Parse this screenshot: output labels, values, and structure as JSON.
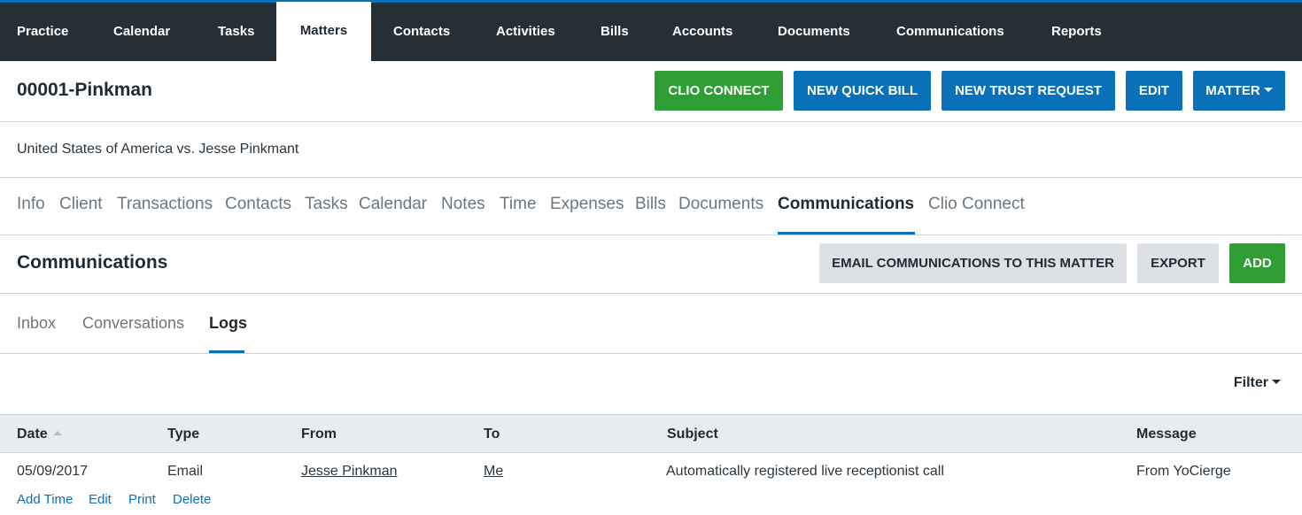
{
  "topnav": {
    "items": [
      {
        "label": "Practice"
      },
      {
        "label": "Calendar"
      },
      {
        "label": "Tasks"
      },
      {
        "label": "Matters"
      },
      {
        "label": "Contacts"
      },
      {
        "label": "Activities"
      },
      {
        "label": "Bills"
      },
      {
        "label": "Accounts"
      },
      {
        "label": "Documents"
      },
      {
        "label": "Communications"
      },
      {
        "label": "Reports"
      }
    ],
    "active": "Matters"
  },
  "header": {
    "title": "00001-Pinkman",
    "buttons": {
      "clio_connect": "CLIO CONNECT",
      "new_quick_bill": "NEW QUICK BILL",
      "new_trust_request": "NEW TRUST REQUEST",
      "edit": "EDIT",
      "matter": "MATTER"
    }
  },
  "matter": {
    "description": "United States of America vs. Jesse Pinkmant"
  },
  "matter_tabs": {
    "items": [
      {
        "label": "Info"
      },
      {
        "label": "Client"
      },
      {
        "label": "Transactions"
      },
      {
        "label": "Contacts"
      },
      {
        "label": "Tasks"
      },
      {
        "label": "Calendar"
      },
      {
        "label": "Notes"
      },
      {
        "label": "Time"
      },
      {
        "label": "Expenses"
      },
      {
        "label": "Bills"
      },
      {
        "label": "Documents"
      },
      {
        "label": "Communications"
      },
      {
        "label": "Clio Connect"
      }
    ],
    "active": "Communications"
  },
  "section": {
    "title": "Communications",
    "buttons": {
      "email_comms": "EMAIL COMMUNICATIONS TO THIS MATTER",
      "export": "EXPORT",
      "add": "ADD"
    }
  },
  "sub_tabs": {
    "items": [
      {
        "label": "Inbox"
      },
      {
        "label": "Conversations"
      },
      {
        "label": "Logs"
      }
    ],
    "active": "Logs"
  },
  "filter": {
    "label": "Filter"
  },
  "table": {
    "columns": [
      "Date",
      "Type",
      "From",
      "To",
      "Subject",
      "Message"
    ],
    "sort_column": "Date",
    "rows": [
      {
        "date": "05/09/2017",
        "type": "Email",
        "from": "Jesse Pinkman",
        "to": "Me",
        "subject": "Automatically registered live receptionist call",
        "message": "From YoCierge",
        "actions": [
          "Add Time",
          "Edit",
          "Print",
          "Delete"
        ]
      }
    ]
  },
  "colors": {
    "nav_bg": "#262f36",
    "accent_blue": "#0a70b8",
    "green": "#2f9e35",
    "grey_button": "#dde1e5"
  }
}
